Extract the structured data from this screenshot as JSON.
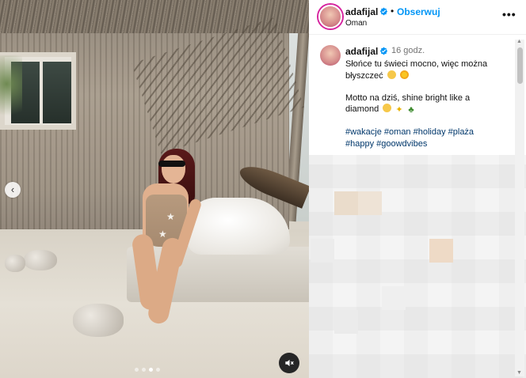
{
  "post": {
    "username": "adafijal",
    "separator": "•",
    "follow_label": "Obserwuj",
    "location": "Oman",
    "more_label": "•••"
  },
  "caption": {
    "username": "adafijal",
    "time": "16 godz.",
    "line1": "Słońce tu świeci mocno, więc można",
    "line2": "błyszczeć",
    "line3": "Motto na dziś, shine bright like a",
    "line4": "diamond",
    "hashtags_line1": "#wakacje #oman #holiday #plaża",
    "hashtags_line2": "#happy #goowdvibes"
  },
  "media": {
    "carousel_dots": 4,
    "active_dot": 3
  },
  "icons": {
    "verified": "verified-badge-icon",
    "more": "more-options-icon",
    "prev": "chevron-left-icon",
    "mute": "volume-muted-icon"
  },
  "colors": {
    "follow": "#0095f6",
    "hashtag": "#00376b",
    "verified": "#0095f6",
    "timestamp": "#737373"
  }
}
